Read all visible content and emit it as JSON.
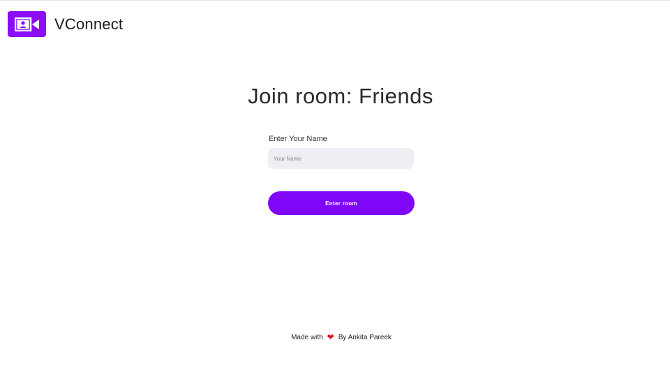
{
  "header": {
    "brand_name": "VConnect",
    "logo_icon": "video-camera-icon",
    "brand_color": "#8b0cf5"
  },
  "main": {
    "title": "Join room: Friends",
    "name_field": {
      "label": "Enter Your Name",
      "placeholder": "Your Name",
      "value": ""
    },
    "enter_button_label": "Enter room",
    "button_color": "#7f06f7"
  },
  "footer": {
    "prefix": "Made with",
    "heart_icon": "heart-icon",
    "heart_color": "#e0141e",
    "suffix": "By Ankita Pareek"
  }
}
